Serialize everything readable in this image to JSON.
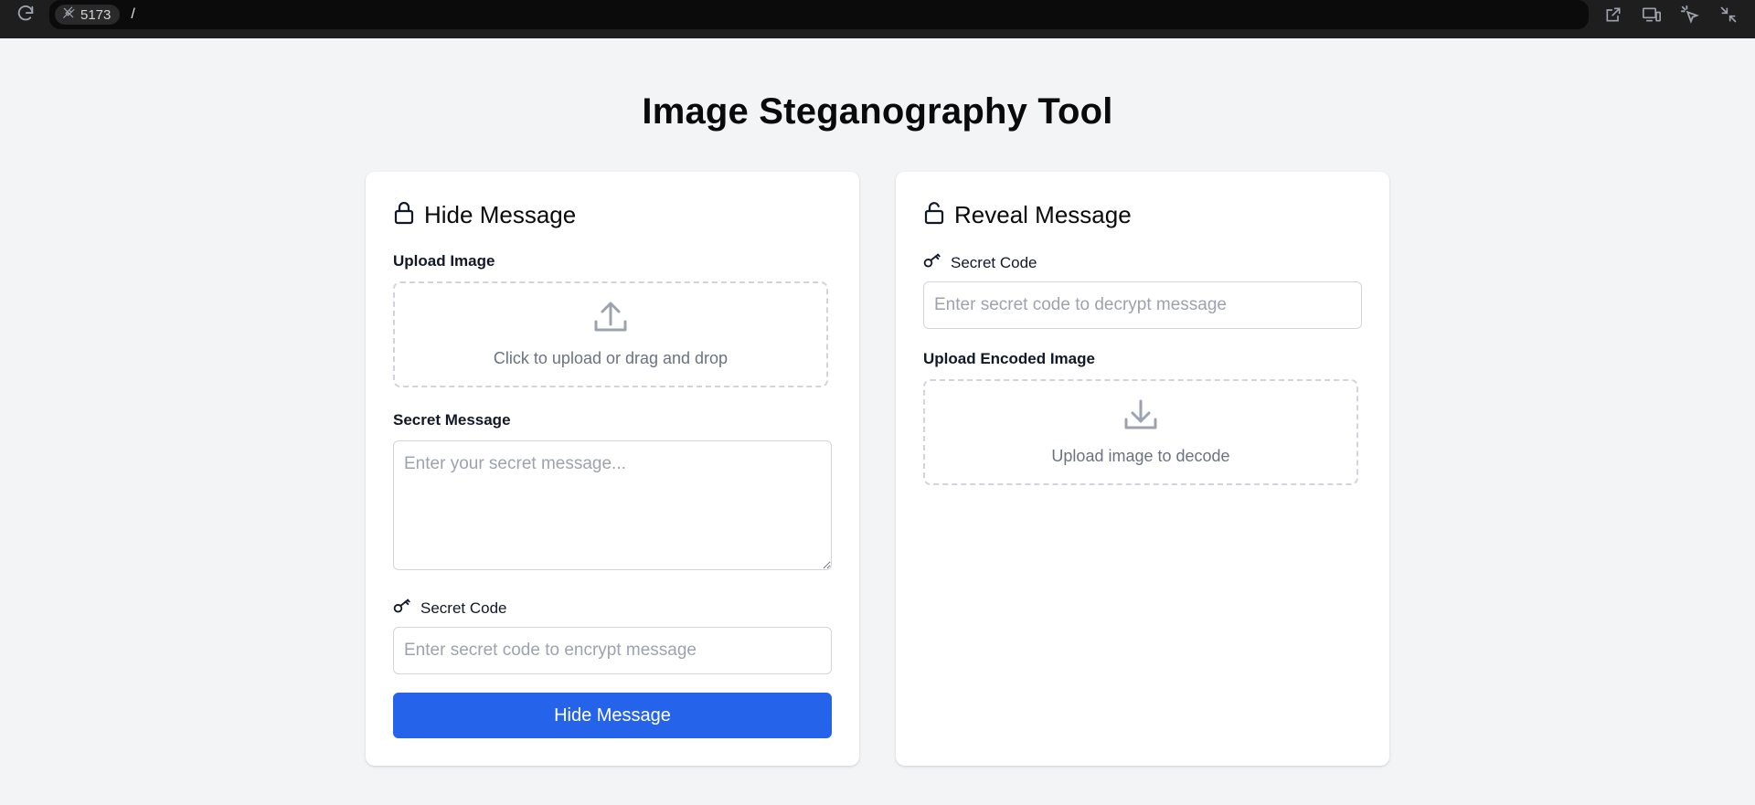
{
  "browser": {
    "port": "5173",
    "path": "/",
    "icons": [
      "reload-icon",
      "plug-icon",
      "open-external-icon",
      "devices-icon",
      "pointer-select-icon",
      "minimize-icon"
    ]
  },
  "page": {
    "title": "Image Steganography Tool"
  },
  "hide_card": {
    "title": "Hide Message",
    "upload_label": "Upload Image",
    "upload_text": "Click to upload or drag and drop",
    "message_label": "Secret Message",
    "message_placeholder": "Enter your secret message...",
    "code_label": "Secret Code",
    "code_placeholder": "Enter secret code to encrypt message",
    "submit_label": "Hide Message"
  },
  "reveal_card": {
    "title": "Reveal Message",
    "code_label": "Secret Code",
    "code_placeholder": "Enter secret code to decrypt message",
    "upload_label": "Upload Encoded Image",
    "upload_text": "Upload image to decode"
  },
  "colors": {
    "accent": "#2563eb",
    "background": "#f3f4f6",
    "card": "#ffffff",
    "muted_text": "#6b7280"
  }
}
